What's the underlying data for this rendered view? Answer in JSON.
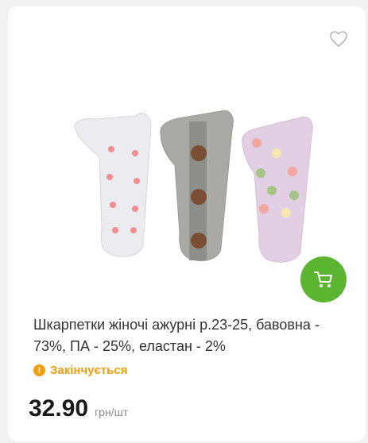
{
  "product": {
    "title": "Шкарпетки жіночі ажурні р.23-25, бавовна - 73%, ПА - 25%, еластан - 2%",
    "status": "Закінчується",
    "price": "32.90",
    "unit": "грн/шт"
  },
  "icons": {
    "favorite": "heart-outline-icon",
    "cart": "cart-icon",
    "status": "exclamation-icon"
  },
  "colors": {
    "accent_green": "#5cb531",
    "warning_orange": "#f29d0c",
    "text": "#333333"
  }
}
